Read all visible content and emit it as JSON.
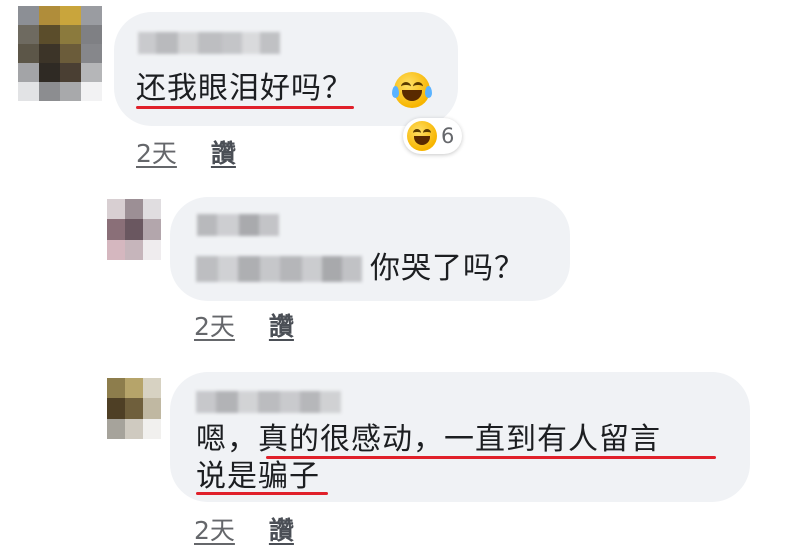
{
  "comments": [
    {
      "text": "还我眼泪好吗？",
      "has_emoji": true,
      "emoji_name": "laughing-tears-emoji",
      "reaction": {
        "emoji": "laughing-squint-emoji",
        "count": "6"
      },
      "time": "2天",
      "like_label": "讚"
    }
  ],
  "replies": [
    {
      "text": "你哭了吗？",
      "time": "2天",
      "like_label": "讚"
    },
    {
      "text_line1": "嗯，真的很感动，一直到有人留言",
      "text_line2": "说是骗子",
      "time": "2天",
      "like_label": "讚"
    }
  ],
  "colors": {
    "bubble_bg": "#f0f2f5",
    "underline_red": "#e0202a",
    "meta_gray": "#65676b"
  }
}
